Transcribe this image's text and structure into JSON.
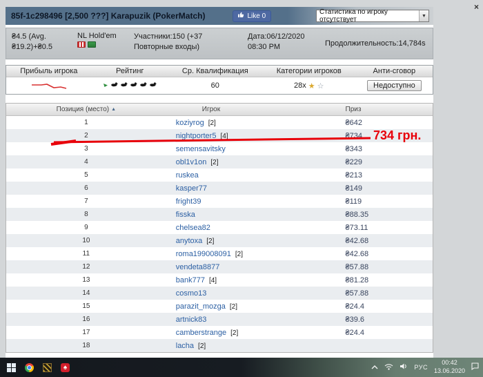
{
  "colors": {
    "annotation_red": "#e8000a",
    "header_bar": "#54708a",
    "like_blue": "#4e69a2",
    "link_blue": "#2b5fa3"
  },
  "icons": {
    "close": "×",
    "dropdown_arrow": "▼",
    "sort_asc": "▲",
    "spade": "♠",
    "trophy": "★",
    "star": "☆"
  },
  "header": {
    "title": "85f-1c298496 [2,500 ???] Karapuzik (PokerMatch)",
    "like_label": "Like 0",
    "stats_dropdown": "Статистика по игроку отсутствует"
  },
  "infobar": {
    "avg": "₴4.5 (Avg. ₴19.2)+₴0.5",
    "game": "NL Hold'em",
    "participants": "Участники:150 (+37 Повторные входы)",
    "date": "Дата:06/12/2020 08:30 PM",
    "duration": "Продолжительность:14,784s"
  },
  "statspanel": {
    "headers": [
      "Прибыль игрока",
      "Рейтинг",
      "Ср. Квалификация",
      "Категории игроков",
      "Анти-сговор"
    ],
    "qualification": "60",
    "categories_count": "28x",
    "anti_collusion_button": "Недоступно",
    "rating_icon_count": 5
  },
  "annotation": {
    "text": "734 грн."
  },
  "table": {
    "headers": {
      "position": "Позиция (место)",
      "player": "Игрок",
      "prize": "Приз"
    },
    "rows": [
      {
        "pos": "1",
        "player": "koziyrog",
        "entries": "[2]",
        "prize": "₴642"
      },
      {
        "pos": "2",
        "player": "nightporter5",
        "entries": "[4]",
        "prize": "₴734"
      },
      {
        "pos": "3",
        "player": "semensavitsky",
        "entries": "",
        "prize": "₴343"
      },
      {
        "pos": "4",
        "player": "obl1v1on",
        "entries": "[2]",
        "prize": "₴229"
      },
      {
        "pos": "5",
        "player": "ruskea",
        "entries": "",
        "prize": "₴213"
      },
      {
        "pos": "6",
        "player": "kasper77",
        "entries": "",
        "prize": "₴149"
      },
      {
        "pos": "7",
        "player": "fright39",
        "entries": "",
        "prize": "₴119"
      },
      {
        "pos": "8",
        "player": "fisska",
        "entries": "",
        "prize": "₴88.35"
      },
      {
        "pos": "9",
        "player": "chelsea82",
        "entries": "",
        "prize": "₴73.11"
      },
      {
        "pos": "10",
        "player": "anytoxa",
        "entries": "[2]",
        "prize": "₴42.68"
      },
      {
        "pos": "11",
        "player": "roma199008091",
        "entries": "[2]",
        "prize": "₴42.68"
      },
      {
        "pos": "12",
        "player": "vendeta8877",
        "entries": "",
        "prize": "₴57.88"
      },
      {
        "pos": "13",
        "player": "bank777",
        "entries": "[4]",
        "prize": "₴81.28"
      },
      {
        "pos": "14",
        "player": "cosmo13",
        "entries": "",
        "prize": "₴57.88"
      },
      {
        "pos": "15",
        "player": "parazit_mozga",
        "entries": "[2]",
        "prize": "₴24.4"
      },
      {
        "pos": "16",
        "player": "artnick83",
        "entries": "",
        "prize": "₴39.6"
      },
      {
        "pos": "17",
        "player": "camberstrange",
        "entries": "[2]",
        "prize": "₴24.4"
      },
      {
        "pos": "18",
        "player": "lacha",
        "entries": "[2]",
        "prize": ""
      }
    ]
  },
  "taskbar": {
    "lang": "РУС",
    "time": "00:42",
    "date": "13.06.2020"
  }
}
